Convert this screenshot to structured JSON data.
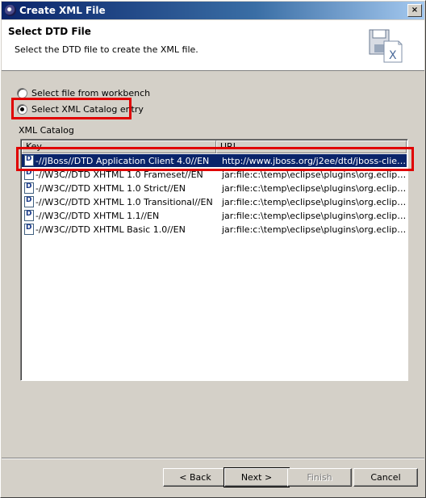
{
  "window": {
    "title": "Create XML File",
    "close_glyph": "×"
  },
  "header": {
    "title": "Select DTD File",
    "description": "Select the DTD file to create the XML file.",
    "icon": "xml-file-wizard-icon"
  },
  "source_options": {
    "workbench_label": "Select file from workbench",
    "catalog_label": "Select XML Catalog entry",
    "selected": "catalog"
  },
  "catalog": {
    "group_label": "XML Catalog",
    "columns": [
      "Key",
      "URI"
    ],
    "rows": [
      {
        "key": "-//JBoss//DTD Application Client 4.0//EN",
        "uri": "http://www.jboss.org/j2ee/dtd/jboss-client_...",
        "selected": true
      },
      {
        "key": "-//W3C//DTD XHTML 1.0 Frameset//EN",
        "uri": "jar:file:c:\\temp\\eclipse\\plugins\\org.eclipse.w...",
        "selected": false
      },
      {
        "key": "-//W3C//DTD XHTML 1.0 Strict//EN",
        "uri": "jar:file:c:\\temp\\eclipse\\plugins\\org.eclipse.w...",
        "selected": false
      },
      {
        "key": "-//W3C//DTD XHTML 1.0 Transitional//EN",
        "uri": "jar:file:c:\\temp\\eclipse\\plugins\\org.eclipse.w...",
        "selected": false
      },
      {
        "key": "-//W3C//DTD XHTML 1.1//EN",
        "uri": "jar:file:c:\\temp\\eclipse\\plugins\\org.eclipse.w...",
        "selected": false
      },
      {
        "key": "-//W3C//DTD XHTML Basic 1.0//EN",
        "uri": "jar:file:c:\\temp\\eclipse\\plugins\\org.eclipse.w...",
        "selected": false
      }
    ]
  },
  "buttons": {
    "back": "< Back",
    "next": "Next >",
    "finish": "Finish",
    "cancel": "Cancel"
  },
  "colors": {
    "selection": "#0a246a",
    "highlight_box": "#e00000",
    "dialog_face": "#d4d0c8"
  }
}
